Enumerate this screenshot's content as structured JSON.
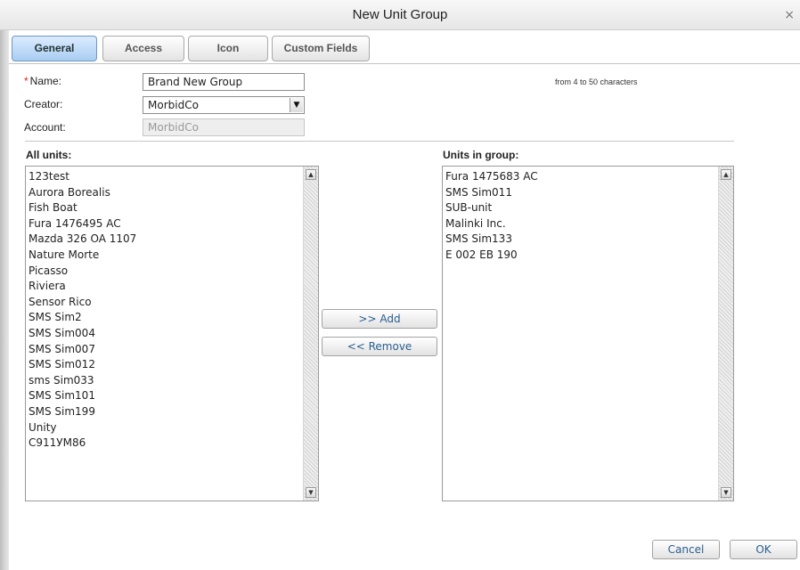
{
  "dialog": {
    "title": "New Unit Group",
    "close_glyph": "×"
  },
  "tabs": [
    {
      "label": "General",
      "active": true
    },
    {
      "label": "Access",
      "active": false
    },
    {
      "label": "Icon",
      "active": false
    },
    {
      "label": "Custom Fields",
      "active": false
    }
  ],
  "form": {
    "name": {
      "required_mark": "*",
      "label": "Name:",
      "value": "Brand New Group",
      "hint": "from 4 to 50 characters"
    },
    "creator": {
      "label": "Creator:",
      "value": "MorbidCo",
      "arrow_glyph": "▼"
    },
    "account": {
      "label": "Account:",
      "value": "MorbidCo"
    }
  },
  "all_units": {
    "title": "All units:",
    "items": [
      "123test",
      "Aurora Borealis",
      "Fish Boat",
      "Fura 1476495 AC",
      "Mazda 326 OA 1107",
      "Nature Morte",
      "Picasso",
      "Riviera",
      "Sensor Rico",
      "SMS Sim2",
      "SMS Sim004",
      "SMS Sim007",
      "SMS Sim012",
      "sms Sim033",
      "SMS Sim101",
      "SMS Sim199",
      "Unity",
      "С911УМ86"
    ]
  },
  "units_in_group": {
    "title": "Units in group:",
    "items": [
      "Fura 1475683 AC",
      "SMS Sim011",
      "SUB-unit",
      "Malinki Inc.",
      "SMS Sim133",
      "E 002 EB 190"
    ]
  },
  "scroll_glyphs": {
    "up": "▲",
    "down": "▼"
  },
  "actions": {
    "add_label": ">> Add",
    "remove_label": "<< Remove",
    "cancel_label": "Cancel",
    "ok_label": "OK"
  },
  "colors": {
    "active_tab": "#a9cdf2",
    "button_text": "#2a5f8f",
    "required": "#dd2222"
  }
}
